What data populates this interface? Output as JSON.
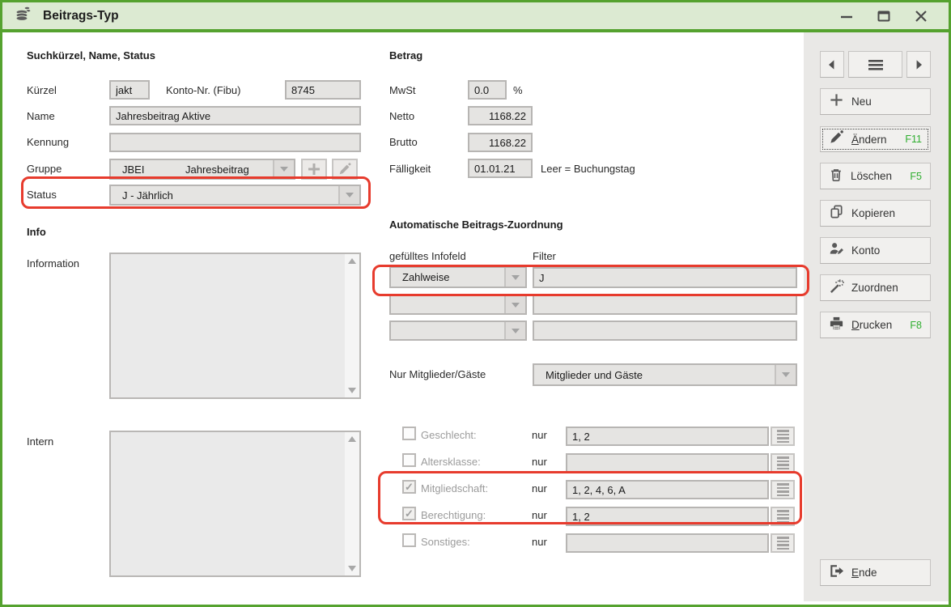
{
  "window": {
    "title": "Beitrags-Typ"
  },
  "s1": {
    "heading": "Suchkürzel, Name, Status",
    "kuerzel": {
      "label": "Kürzel",
      "value": "jakt"
    },
    "konto": {
      "label": "Konto-Nr. (Fibu)",
      "value": "8745"
    },
    "name": {
      "label": "Name",
      "value": "Jahresbeitrag Aktive"
    },
    "kennung": {
      "label": "Kennung",
      "value": ""
    },
    "gruppe": {
      "label": "Gruppe",
      "code": "JBEI",
      "name": "Jahresbeitrag"
    },
    "status": {
      "label": "Status",
      "value": "J - Jährlich"
    }
  },
  "info": {
    "heading": "Info",
    "information_label": "Information",
    "information_value": "",
    "intern_label": "Intern",
    "intern_value": ""
  },
  "betrag": {
    "heading": "Betrag",
    "mwst": {
      "label": "MwSt",
      "value": "0.0",
      "unit": "%"
    },
    "netto": {
      "label": "Netto",
      "value": "1168.22"
    },
    "brutto": {
      "label": "Brutto",
      "value": "1168.22"
    },
    "faelligkeit": {
      "label": "Fälligkeit",
      "value": "01.01.21",
      "hint": "Leer = Buchungstag"
    }
  },
  "zuordnung": {
    "heading": "Automatische Beitrags-Zuordnung",
    "infofeld_label": "gefülltes Infofeld",
    "filter_label": "Filter",
    "rows": [
      {
        "infofeld": "Zahlweise",
        "filter": "J"
      },
      {
        "infofeld": "",
        "filter": ""
      },
      {
        "infofeld": "",
        "filter": ""
      }
    ],
    "mitglieder": {
      "label": "Nur Mitglieder/Gäste",
      "value": "Mitglieder und Gäste"
    },
    "filters": [
      {
        "label": "Geschlecht:",
        "nur": "nur",
        "value": "1, 2",
        "checked": false
      },
      {
        "label": "Altersklasse:",
        "nur": "nur",
        "value": "",
        "checked": false
      },
      {
        "label": "Mitgliedschaft:",
        "nur": "nur",
        "value": "1, 2, 4, 6, A",
        "checked": true
      },
      {
        "label": "Berechtigung:",
        "nur": "nur",
        "value": "1, 2",
        "checked": true
      },
      {
        "label": "Sonstiges:",
        "nur": "nur",
        "value": "",
        "checked": false
      }
    ],
    "check_glyph": "✓"
  },
  "sidebar": {
    "buttons": [
      {
        "label": "Neu",
        "fkey": ""
      },
      {
        "label": "Ändern",
        "fkey": "F11"
      },
      {
        "label": "Löschen",
        "fkey": "F5"
      },
      {
        "label": "Kopieren",
        "fkey": ""
      },
      {
        "label": "Konto",
        "fkey": ""
      },
      {
        "label": "Zuordnen",
        "fkey": ""
      },
      {
        "label": "Drucken",
        "fkey": "F8"
      },
      {
        "label": "Ende",
        "fkey": ""
      }
    ]
  },
  "colors": {
    "window_green": "#55a22f",
    "titlebar_bg": "#dcead2",
    "highlight_red": "#e73b2d",
    "fkey_green": "#2fae2f",
    "sidebar_bg": "#e9e8e6"
  }
}
